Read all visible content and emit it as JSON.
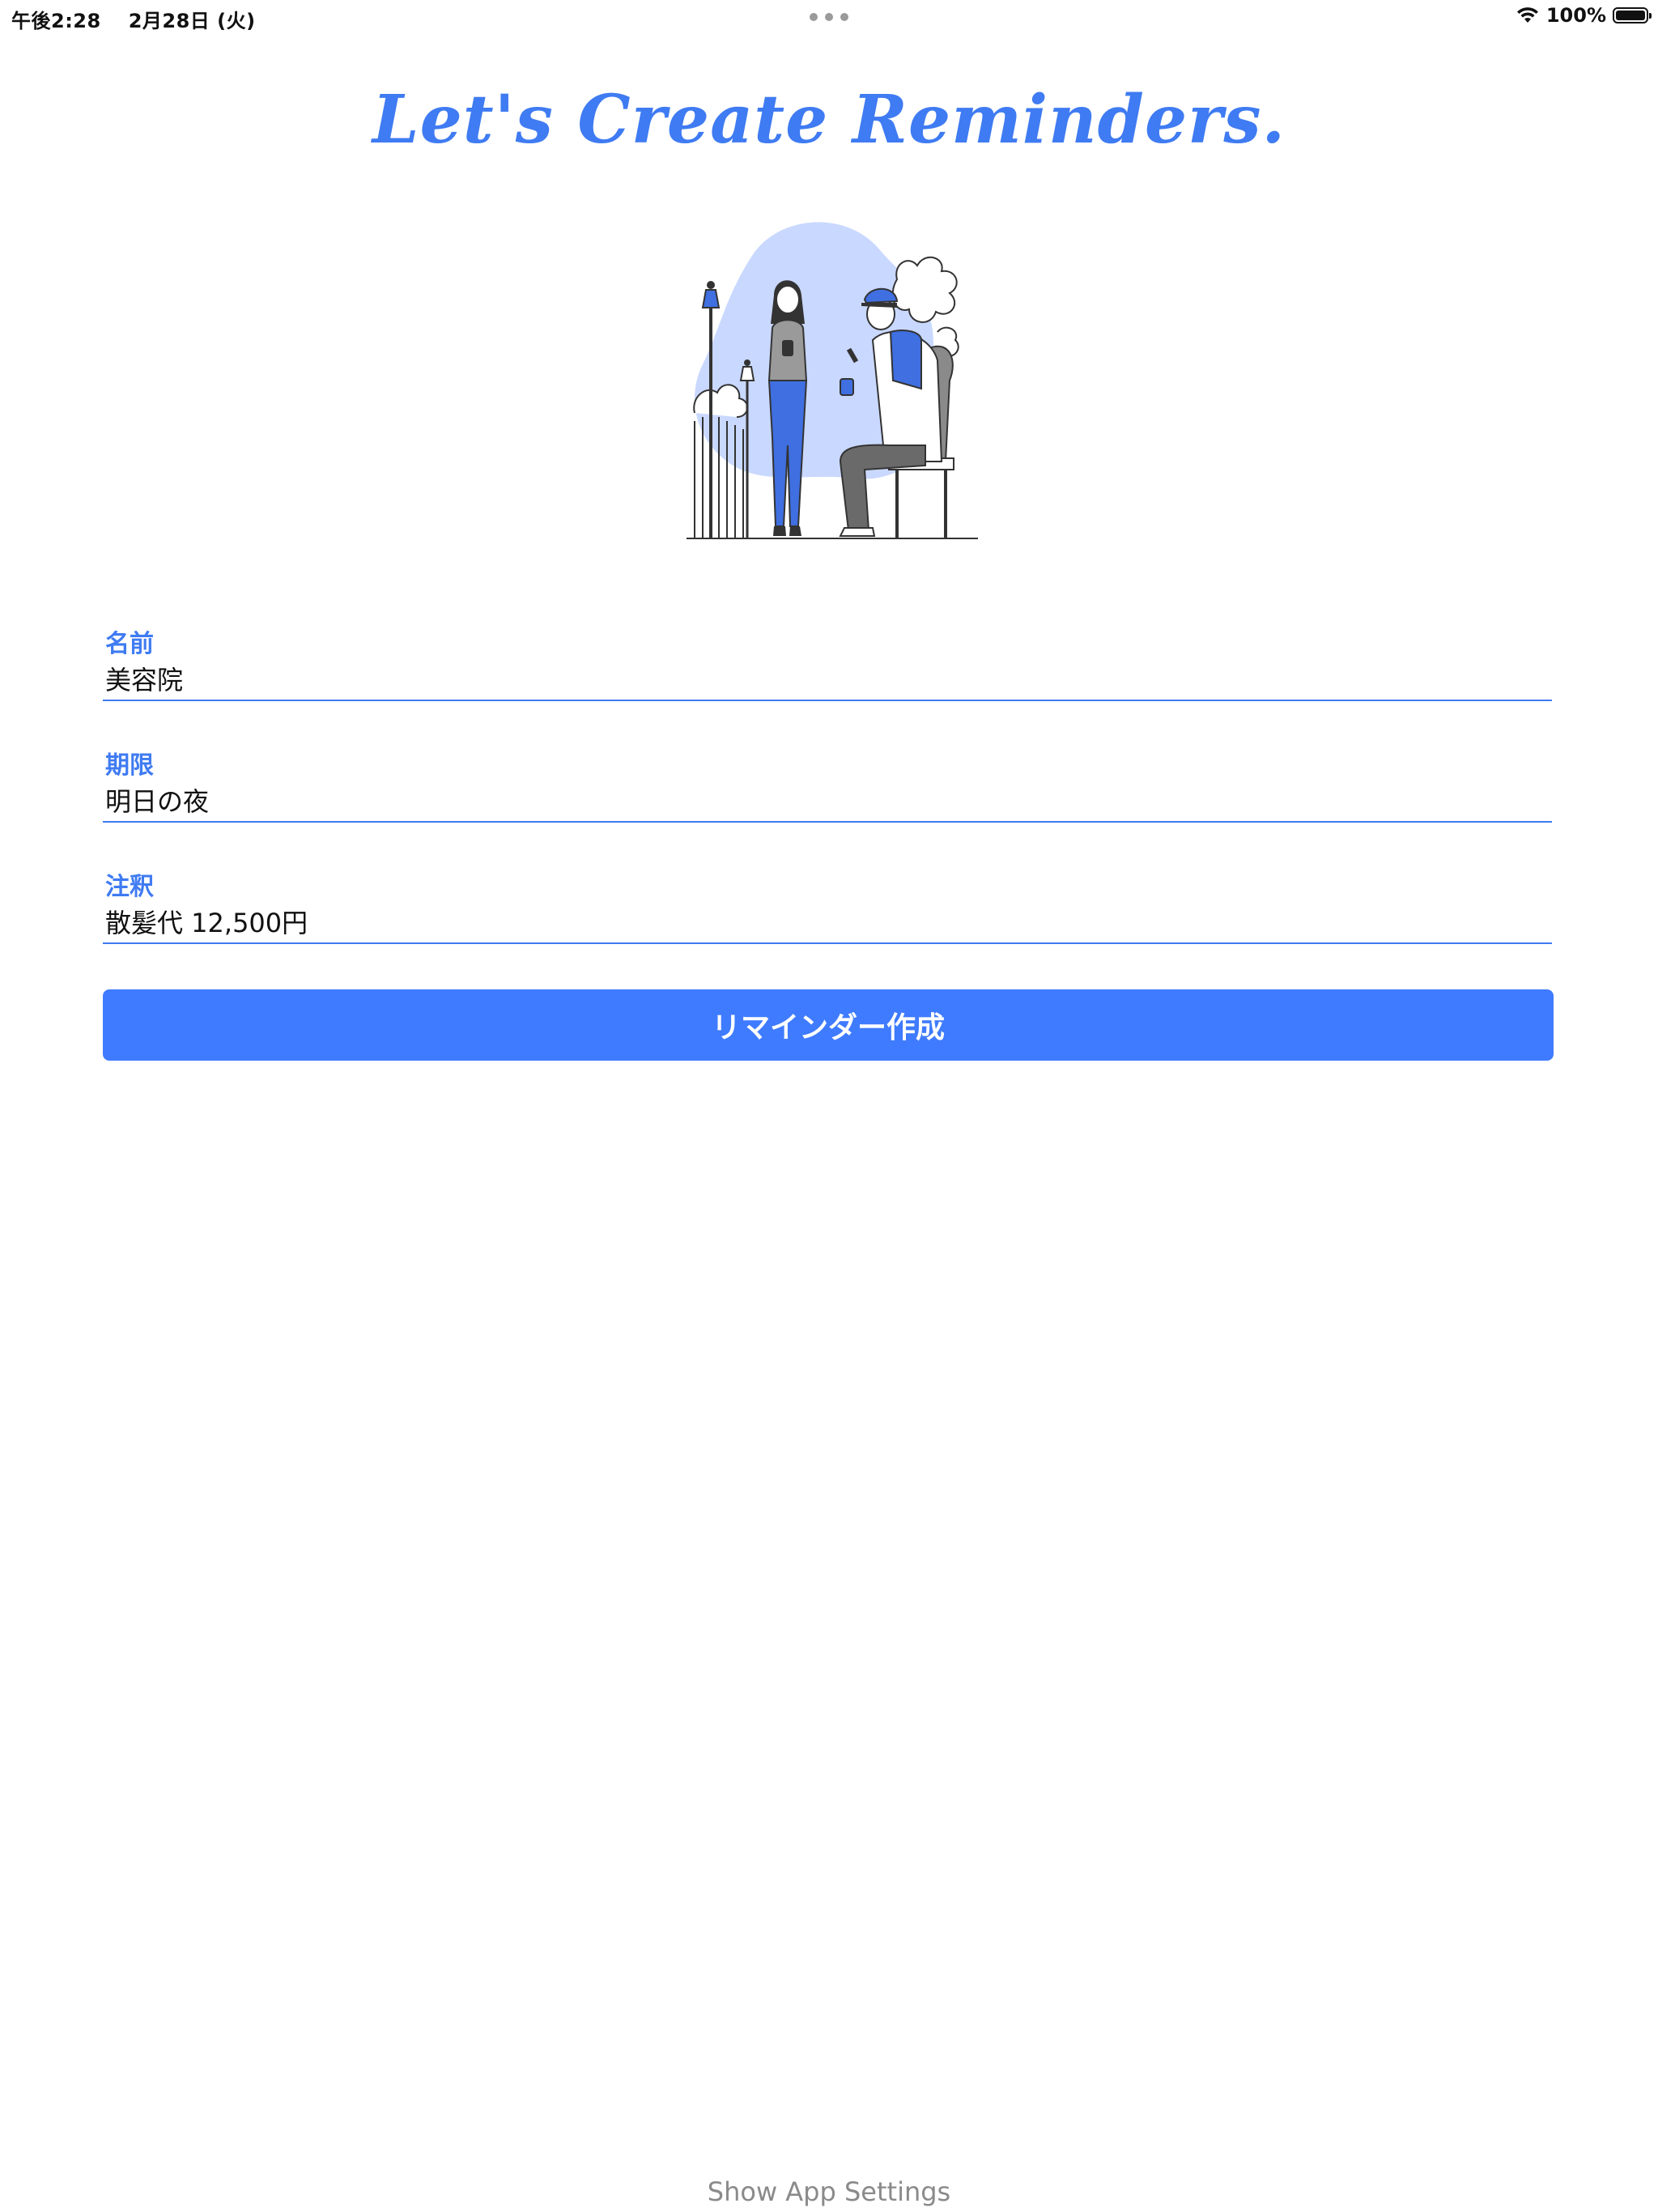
{
  "status_bar": {
    "time": "午後2:28",
    "date": "2月28日 (火)",
    "battery_percent": "100%",
    "battery_level": 1.0
  },
  "header": {
    "title": "Let's Create Reminders."
  },
  "form": {
    "fields": [
      {
        "label": "名前",
        "value": "美容院"
      },
      {
        "label": "期限",
        "value": "明日の夜"
      },
      {
        "label": "注釈",
        "value": "散髪代 12,500円"
      }
    ],
    "submit_label": "リマインダー作成"
  },
  "footer": {
    "settings_link": "Show App Settings"
  },
  "colors": {
    "accent": "#3f7bf2",
    "button": "#3f7bff",
    "illustration_blob": "#c9d8ff"
  }
}
